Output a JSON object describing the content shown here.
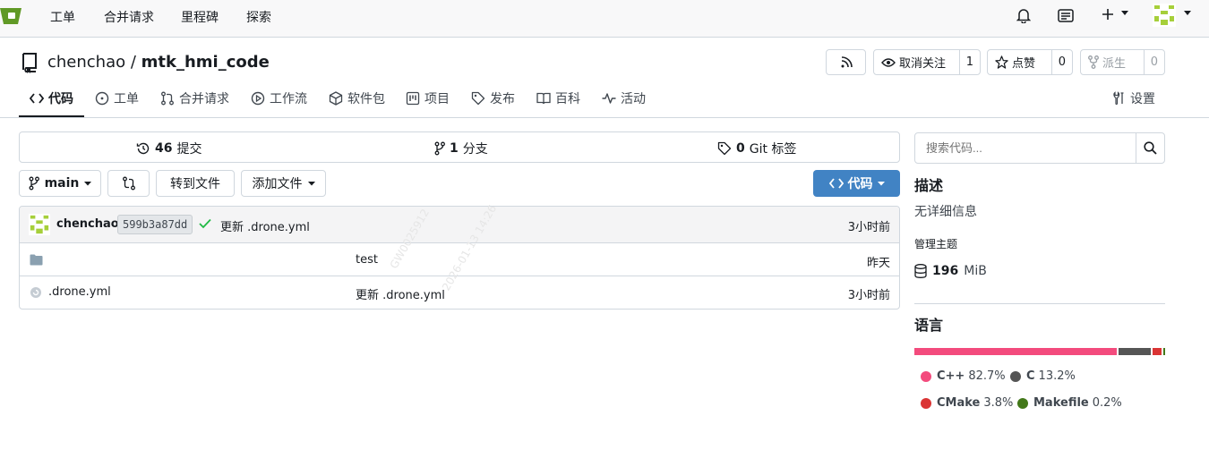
{
  "topnav": {
    "links": [
      "工单",
      "合并请求",
      "里程碑",
      "探索"
    ]
  },
  "repo": {
    "owner": "chenchao",
    "separator": " / ",
    "name": "mtk_hmi_code",
    "watch_label": "取消关注",
    "watch_count": "1",
    "star_label": "点赞",
    "star_count": "0",
    "fork_label": "派生",
    "fork_count": "0"
  },
  "tabs": [
    {
      "label": "代码",
      "icon": "code-icon"
    },
    {
      "label": "工单",
      "icon": "issue-icon"
    },
    {
      "label": "合并请求",
      "icon": "pull-request-icon"
    },
    {
      "label": "工作流",
      "icon": "play-icon"
    },
    {
      "label": "软件包",
      "icon": "package-icon"
    },
    {
      "label": "项目",
      "icon": "project-icon"
    },
    {
      "label": "发布",
      "icon": "tag-icon"
    },
    {
      "label": "百科",
      "icon": "book-icon"
    },
    {
      "label": "活动",
      "icon": "pulse-icon"
    },
    {
      "label": "设置",
      "icon": "tools-icon"
    }
  ],
  "stats": {
    "commits_num": "46",
    "commits_label": "提交",
    "branches_num": "1",
    "branches_label": "分支",
    "tags_num": "0",
    "tags_label": "Git 标签"
  },
  "actions": {
    "branch": "main",
    "goto_file": "转到文件",
    "add_file": "添加文件",
    "code": "代码"
  },
  "latest_commit": {
    "author": "chenchao",
    "sha": "599b3a87dd",
    "message": "更新 .drone.yml",
    "time": "3小时前"
  },
  "files": [
    {
      "name": "",
      "icon": "folder-icon",
      "message": "test",
      "time": "昨天"
    },
    {
      "name": ".drone.yml",
      "icon": "file-icon",
      "message": "更新 .drone.yml",
      "time": "3小时前"
    }
  ],
  "sidebar": {
    "search_placeholder": "搜索代码...",
    "desc_title": "描述",
    "desc_text": "无详细信息",
    "topics_label": "管理主题",
    "size_num": "196",
    "size_unit": "MiB",
    "lang_title": "语言"
  },
  "languages": [
    {
      "name": "C++",
      "percent": "82.7%",
      "value": 82.7,
      "color": "#f34b7d"
    },
    {
      "name": "C",
      "percent": "13.2%",
      "value": 13.2,
      "color": "#555555"
    },
    {
      "name": "CMake",
      "percent": "3.8%",
      "value": 3.8,
      "color": "#da3434"
    },
    {
      "name": "Makefile",
      "percent": "0.2%",
      "value": 0.2,
      "color": "#427819"
    }
  ],
  "watermark": [
    "GW0025912",
    "2026-01-13 14:26"
  ]
}
